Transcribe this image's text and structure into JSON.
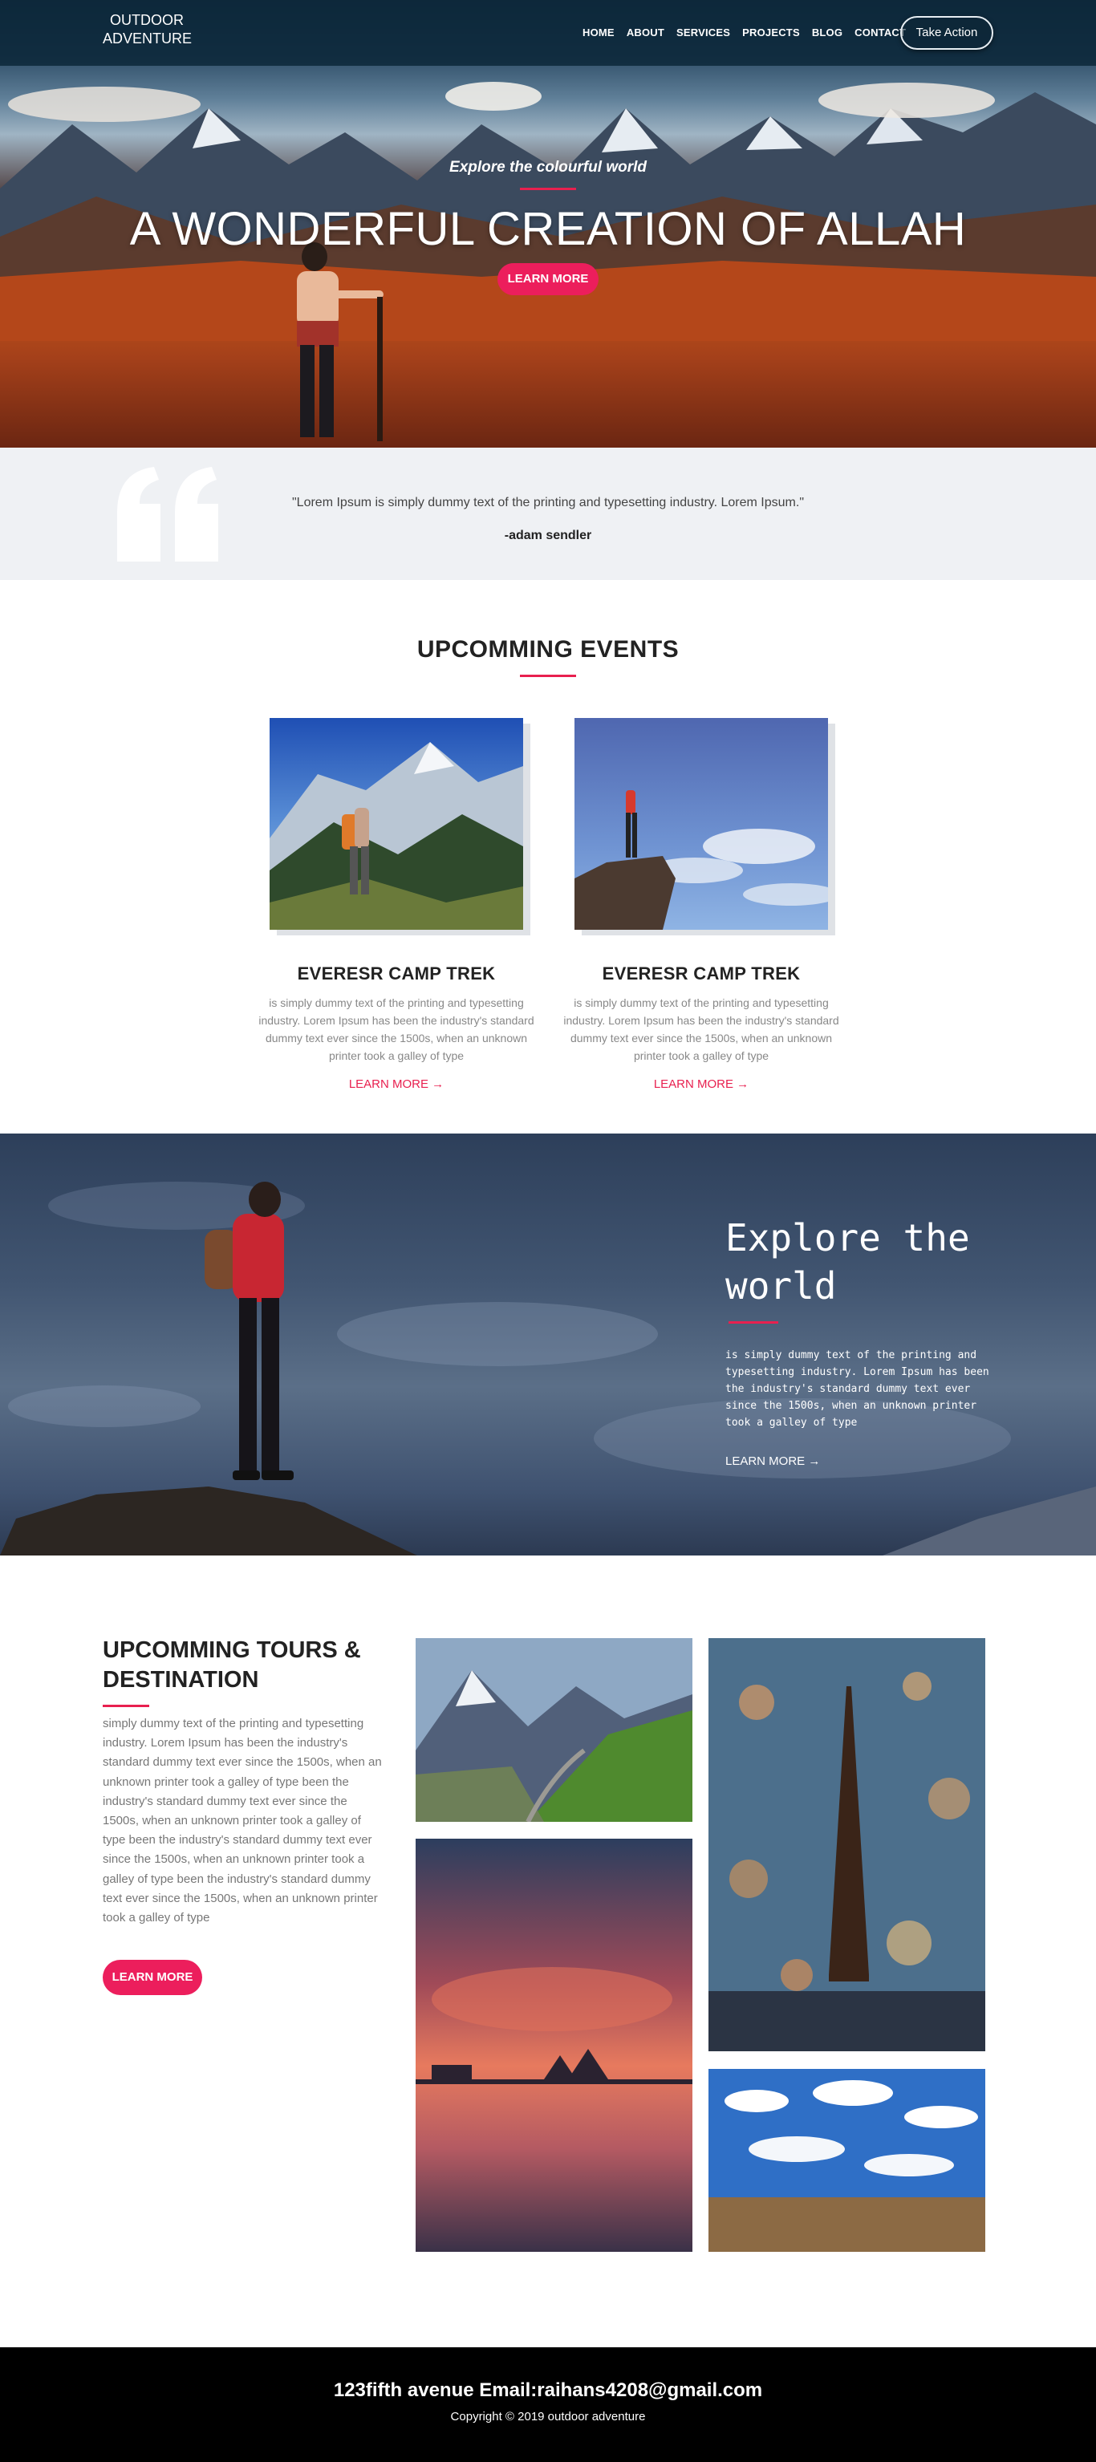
{
  "header": {
    "logo_line1": "OUTDOOR",
    "logo_line2": "ADVENTURE",
    "menu": [
      "HOME",
      "ABOUT",
      "SERVICES",
      "PROJECTS",
      "BLOG",
      "CONTACT"
    ],
    "take_action": "Take Action"
  },
  "hero": {
    "subtitle": "Explore the colourful world",
    "title": "A WONDERFUL CREATION OF ALLAH",
    "button": "LEARN MORE"
  },
  "quote": {
    "text": "\"Lorem Ipsum is simply dummy text of the printing and typesetting industry. Lorem Ipsum.\"",
    "author": "-adam sendler",
    "icon": "quote-icon"
  },
  "events": {
    "title": "UPCOMMING EVENTS",
    "cards": [
      {
        "title": "EVERESR CAMP TREK",
        "text": "is simply dummy text of the printing and typesetting industry. Lorem Ipsum has been the industry's standard dummy text ever since the 1500s, when an unknown printer took a galley of type",
        "link": "LEARN MORE →"
      },
      {
        "title": "EVERESR CAMP TREK",
        "text": "is simply dummy text of the printing and typesetting industry. Lorem Ipsum has been the industry's standard dummy text ever since the 1500s, when an unknown printer took a galley of type",
        "link": "LEARN MORE →"
      }
    ]
  },
  "explore": {
    "title": "Explore the world",
    "text": "is simply dummy text of the printing and typesetting industry. Lorem Ipsum has been the industry's standard dummy text ever since the 1500s, when an unknown printer took a galley of type",
    "link": "LEARN MORE →"
  },
  "tours": {
    "title": "UPCOMMING TOURS & DESTINATION",
    "text": "simply dummy text of the printing and typesetting industry. Lorem Ipsum has been the industry's standard dummy text ever since the 1500s, when an unknown printer took a galley of type been the industry's standard dummy text ever since the 1500s, when an unknown printer took a galley of type been the industry's standard dummy text ever since the 1500s, when an unknown printer took a galley of type been the industry's standard dummy text ever since the 1500s, when an unknown printer took a galley of type",
    "button": "LEARN MORE"
  },
  "footer": {
    "contact": "123fifth avenue Email:raihans4208@gmail.com",
    "copyright": "Copyright © 2019 outdoor adventure"
  },
  "colors": {
    "accent": "#e8204f",
    "nav_bg": "#0d283a",
    "quote_bg": "#eff1f4",
    "footer_bg": "#000000"
  }
}
